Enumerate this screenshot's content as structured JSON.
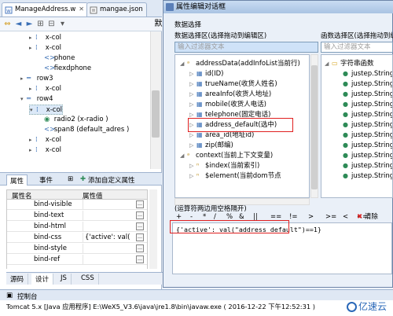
{
  "editor_tabs": [
    {
      "label": "ManageAddress.w",
      "close": "✕"
    },
    {
      "label": "mangae.json",
      "close": ""
    }
  ],
  "toolbar_partial": "默",
  "tree": [
    {
      "label": "x-col",
      "depth": 3,
      "icon": "cell"
    },
    {
      "label": "x-col",
      "depth": 3,
      "icon": "cell"
    },
    {
      "label": "phone",
      "depth": 4,
      "icon": "tag"
    },
    {
      "label": "fiexdphone",
      "depth": 4,
      "icon": "tag"
    },
    {
      "label": "row3",
      "depth": 2,
      "icon": "row"
    },
    {
      "label": "x-col",
      "depth": 3,
      "icon": "cell"
    },
    {
      "label": "row4",
      "depth": 2,
      "icon": "row"
    },
    {
      "label": "x-col",
      "depth": 3,
      "icon": "cell"
    },
    {
      "label": "radio2 (x-radio )",
      "depth": 4,
      "icon": "radio"
    },
    {
      "label": "span8 (default_adres )",
      "depth": 4,
      "icon": "tag"
    },
    {
      "label": "x-col",
      "depth": 3,
      "icon": "cell"
    },
    {
      "label": "x-col",
      "depth": 3,
      "icon": "cell"
    }
  ],
  "props_tabs": [
    "属性",
    "事件",
    "添加自定义属性"
  ],
  "props_header": {
    "name": "属性名",
    "value": "属性值"
  },
  "props_rows": [
    {
      "name": "bind-visible",
      "value": ""
    },
    {
      "name": "bind-text",
      "value": ""
    },
    {
      "name": "bind-html",
      "value": ""
    },
    {
      "name": "bind-css",
      "value": "{'active': val(\"ac"
    },
    {
      "name": "bind-style",
      "value": ""
    },
    {
      "name": "bind-ref",
      "value": ""
    }
  ],
  "bottom_tabs": [
    "源码",
    "设计",
    "JS",
    "CSS"
  ],
  "console": {
    "title": "控制台",
    "line": "Tomcat 5.x [Java 应用程序] E:\\WeX5_V3.6\\java\\jre1.8\\bin\\javaw.exe ( 2016-12-22 下午12:52:31 )"
  },
  "dialog": {
    "title": "属性编辑对话框",
    "section": "数据选择",
    "var_label": "数据选择区(选择拖动到编辑区)",
    "fn_label": "函数选择区(选择拖动到编",
    "var_filter": "输入过滤器文本",
    "fn_filter": "输入过滤器文本",
    "var_tree": [
      {
        "label": "addressData(addInfoList当前行)",
        "depth": 0,
        "open": true,
        "icon": "data"
      },
      {
        "label": "id(ID)",
        "depth": 1,
        "icon": "field"
      },
      {
        "label": "trueName(收货人姓名)",
        "depth": 1,
        "icon": "field"
      },
      {
        "label": "areaInfo(收货人地址)",
        "depth": 1,
        "icon": "field"
      },
      {
        "label": "mobile(收货人电话)",
        "depth": 1,
        "icon": "field"
      },
      {
        "label": "telephone(固定电话)",
        "depth": 1,
        "icon": "field"
      },
      {
        "label": "address_default(选中)",
        "depth": 1,
        "icon": "field"
      },
      {
        "label": "area_id(地址id)",
        "depth": 1,
        "icon": "field"
      },
      {
        "label": "zip(邮编)",
        "depth": 1,
        "icon": "field"
      },
      {
        "label": "context(当前上下文变量)",
        "depth": 0,
        "open": true,
        "icon": "data"
      },
      {
        "label": "$index(当前索引)",
        "depth": 1,
        "icon": "var"
      },
      {
        "label": "$element(当前dom节点",
        "depth": 1,
        "icon": "var"
      }
    ],
    "fn_tree": [
      {
        "label": "字符串函数",
        "depth": 0,
        "icon": "folder"
      },
      {
        "label": "justep.String",
        "depth": 1,
        "icon": "fn"
      },
      {
        "label": "justep.String",
        "depth": 1,
        "icon": "fn"
      },
      {
        "label": "justep.String",
        "depth": 1,
        "icon": "fn"
      },
      {
        "label": "justep.String",
        "depth": 1,
        "icon": "fn"
      },
      {
        "label": "justep.String",
        "depth": 1,
        "icon": "fn"
      },
      {
        "label": "justep.String",
        "depth": 1,
        "icon": "fn"
      },
      {
        "label": "justep.String",
        "depth": 1,
        "icon": "fn"
      },
      {
        "label": "justep.String",
        "depth": 1,
        "icon": "fn"
      },
      {
        "label": "justep.String",
        "depth": 1,
        "icon": "fn"
      },
      {
        "label": "justep.String",
        "depth": 1,
        "icon": "fn"
      },
      {
        "label": "justep.String",
        "depth": 1,
        "icon": "fn"
      }
    ],
    "operator_hint": "(运算符两边用空格隔开)",
    "operators": [
      "+",
      "-",
      "*",
      "/",
      "%",
      "&",
      "||",
      "==",
      "!=",
      ">",
      ">=",
      "<",
      "<="
    ],
    "clear_label": "清除",
    "expression": "{'active': val(\"address_default\")==1}"
  },
  "watermark": "亿速云"
}
